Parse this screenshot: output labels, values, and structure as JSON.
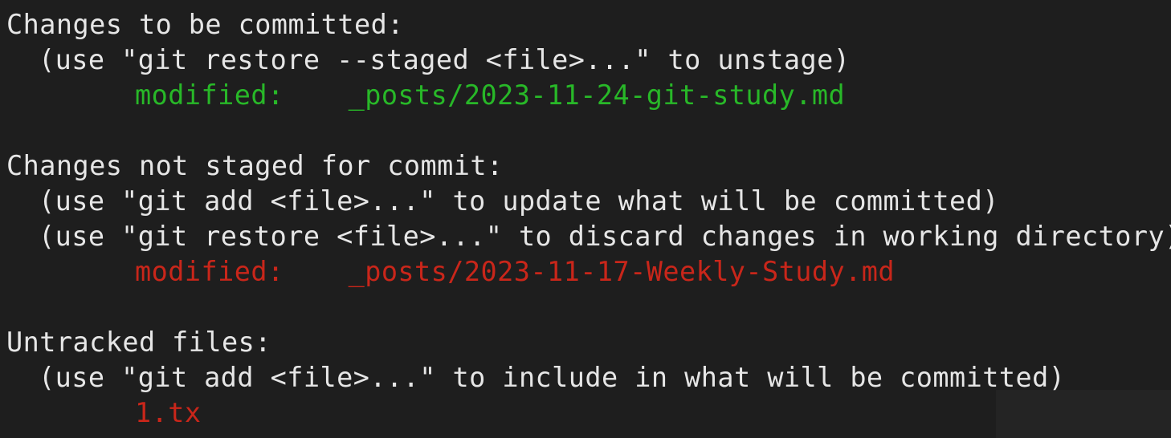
{
  "status": {
    "staged": {
      "heading": "Changes to be committed:",
      "hints": [
        "(use \"git restore --staged <file>...\" to unstage)"
      ],
      "files": [
        {
          "status": "modified:",
          "path": "_posts/2023-11-24-git-study.md"
        }
      ]
    },
    "unstaged": {
      "heading": "Changes not staged for commit:",
      "hints": [
        "(use \"git add <file>...\" to update what will be committed)",
        "(use \"git restore <file>...\" to discard changes in working directory)"
      ],
      "files": [
        {
          "status": "modified:",
          "path": "_posts/2023-11-17-Weekly-Study.md"
        }
      ]
    },
    "untracked": {
      "heading": "Untracked files:",
      "hints": [
        "(use \"git add <file>...\" to include in what will be committed)"
      ],
      "files": [
        "1.tx"
      ]
    }
  },
  "colors": {
    "background": "#1e1e1e",
    "text": "#e6e6e6",
    "staged": "#28b828",
    "unstaged": "#c9261a"
  }
}
